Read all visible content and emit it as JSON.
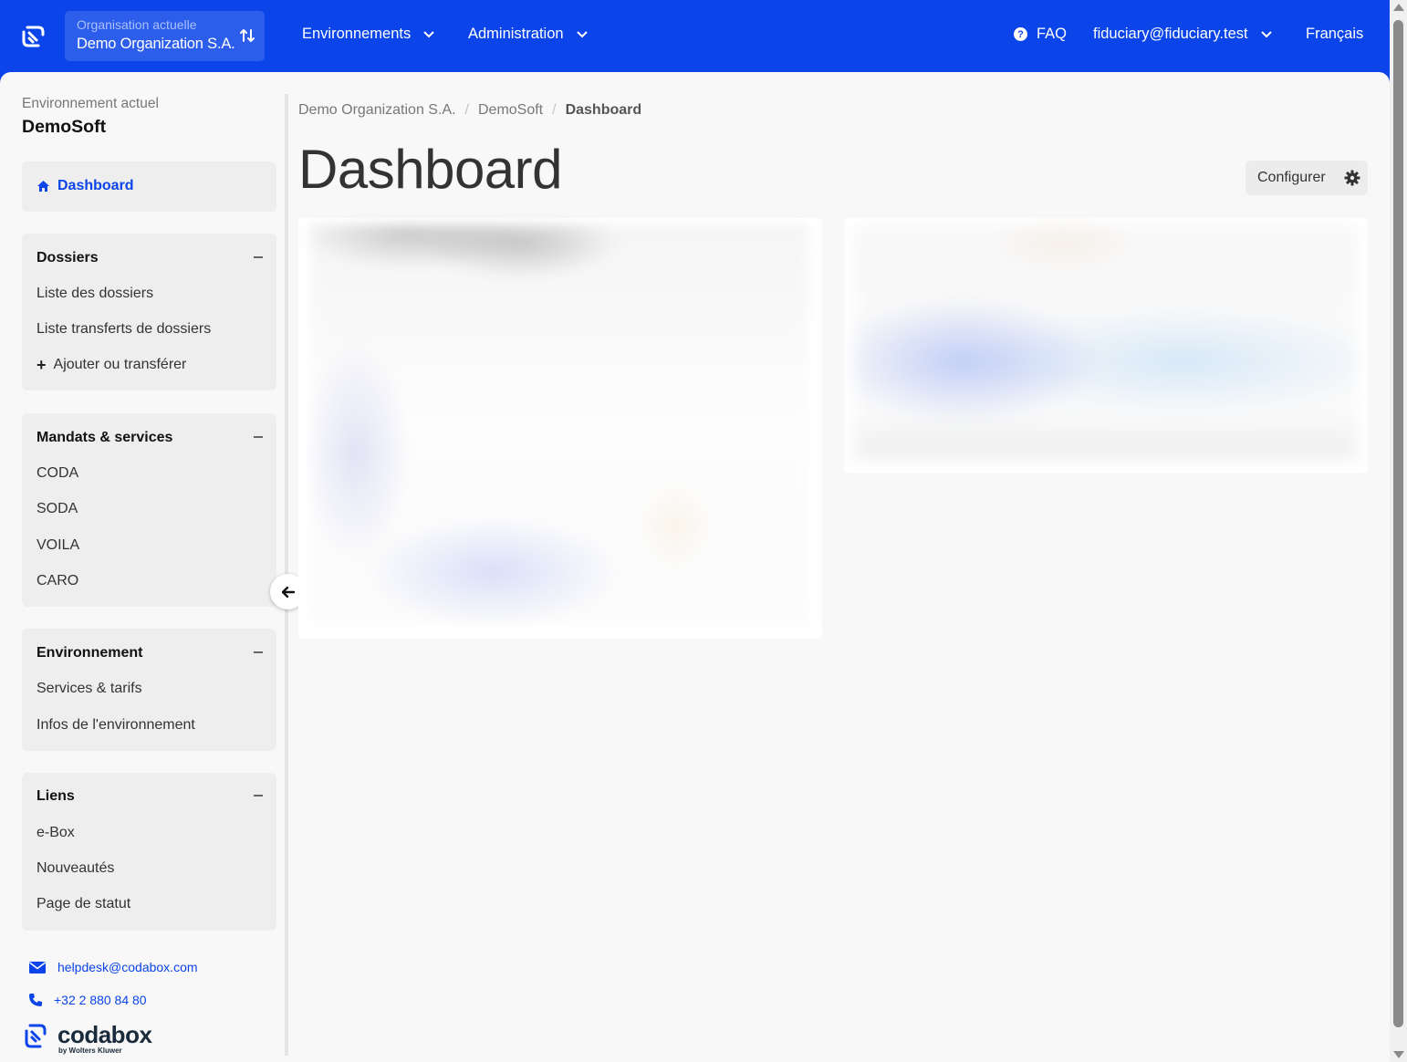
{
  "header": {
    "org_label": "Organisation actuelle",
    "org_name": "Demo Organization S.A.",
    "nav_environments": "Environnements",
    "nav_administration": "Administration",
    "nav_faq": "FAQ",
    "user_email": "fiduciary@fiduciary.test",
    "language": "Français"
  },
  "sidebar": {
    "env_label": "Environnement actuel",
    "env_name": "DemoSoft",
    "dashboard_link": "Dashboard",
    "sections": [
      {
        "title": "Dossiers",
        "items": [
          "Liste des dossiers",
          "Liste transferts de dossiers",
          "Ajouter ou transférer"
        ]
      },
      {
        "title": "Mandats & services",
        "items": [
          "CODA",
          "SODA",
          "VOILA",
          "CARO"
        ]
      },
      {
        "title": "Environnement",
        "items": [
          "Services & tarifs",
          "Infos de l'environnement"
        ]
      },
      {
        "title": "Liens",
        "items": [
          "e-Box",
          "Nouveautés",
          "Page de statut"
        ]
      }
    ],
    "contact_email": "helpdesk@codabox.com",
    "contact_phone": "+32 2 880 84 80",
    "brand_name": "codabox",
    "brand_sub": "by Wolters Kluwer"
  },
  "main": {
    "breadcrumb": [
      "Demo Organization S.A.",
      "DemoSoft",
      "Dashboard"
    ],
    "title": "Dashboard",
    "configure_label": "Configurer"
  },
  "colors": {
    "accent": "#0b44e8",
    "background": "#f8f8f8",
    "card": "#eeeeee"
  }
}
